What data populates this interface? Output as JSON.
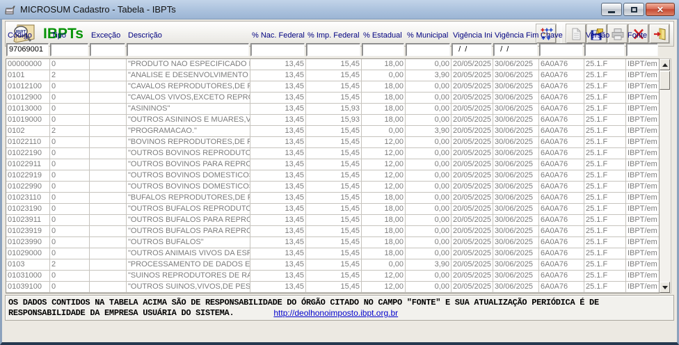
{
  "window": {
    "title": "MICROSUM Cadastro - Tabela - IBPTs",
    "controls": {
      "minimize": "minimize",
      "maximize": "maximize",
      "close": "close"
    }
  },
  "header": {
    "title": "IBPTs"
  },
  "icons": {
    "app": "app-icon",
    "logo": "ibpt-book-magnifier-icon",
    "toolbar": [
      "adjust-columns-icon",
      "document-icon",
      "save-icon",
      "printer-icon",
      "delete-icon",
      "exit-icon"
    ]
  },
  "colors": {
    "band_title_green": "#089408",
    "column_header_navy": "#000080",
    "grid_text_gray": "#7c7c7c",
    "link_blue": "#0000cc",
    "close_button_red": "#c54a33",
    "titlebar_blue": "#a9c0dc"
  },
  "table": {
    "columns": [
      {
        "key": "codigo",
        "label": "Código",
        "filter": "97069001"
      },
      {
        "key": "tipo",
        "label": "Tipo",
        "filter": ""
      },
      {
        "key": "excecao",
        "label": "Exceção",
        "filter": ""
      },
      {
        "key": "descricao",
        "label": "Descrição",
        "filter": ""
      },
      {
        "key": "nac_federal",
        "label": "% Nac. Federal",
        "filter": ""
      },
      {
        "key": "imp_federal",
        "label": "% Imp. Federal",
        "filter": ""
      },
      {
        "key": "estadual",
        "label": "% Estadual",
        "filter": ""
      },
      {
        "key": "municipal",
        "label": "% Municipal",
        "filter": ""
      },
      {
        "key": "vigencia_ini",
        "label": "Vigência Ini.",
        "filter": "  /  /"
      },
      {
        "key": "vigencia_fim",
        "label": "Vigência Fim",
        "filter": "  /  /"
      },
      {
        "key": "chave",
        "label": "Chave",
        "filter": ""
      },
      {
        "key": "versao",
        "label": "Versão",
        "filter": ""
      },
      {
        "key": "fonte",
        "label": "Fonte",
        "filter": ""
      }
    ],
    "rows": [
      [
        "00000000",
        "0",
        "",
        "\"PRODUTO NAO ESPECIFICADO N",
        "13,45",
        "15,45",
        "18,00",
        "0,00",
        "20/05/2025",
        "30/06/2025",
        "6A0A76",
        "25.1.F",
        "IBPT/em"
      ],
      [
        "0101",
        "2",
        "",
        "\"ANALISE E DESENVOLVIMENTO",
        "13,45",
        "15,45",
        "0,00",
        "3,90",
        "20/05/2025",
        "30/06/2025",
        "6A0A76",
        "25.1.F",
        "IBPT/em"
      ],
      [
        "01012100",
        "0",
        "",
        "\"CAVALOS REPRODUTORES,DE R",
        "13,45",
        "15,45",
        "18,00",
        "0,00",
        "20/05/2025",
        "30/06/2025",
        "6A0A76",
        "25.1.F",
        "IBPT/em"
      ],
      [
        "01012900",
        "0",
        "",
        "\"CAVALOS VIVOS,EXCETO REPRO",
        "13,45",
        "15,45",
        "18,00",
        "0,00",
        "20/05/2025",
        "30/06/2025",
        "6A0A76",
        "25.1.F",
        "IBPT/em"
      ],
      [
        "01013000",
        "0",
        "",
        "\"ASININOS\"",
        "13,45",
        "15,93",
        "18,00",
        "0,00",
        "20/05/2025",
        "30/06/2025",
        "6A0A76",
        "25.1.F",
        "IBPT/em"
      ],
      [
        "01019000",
        "0",
        "",
        "\"OUTROS ASININOS E MUARES,V",
        "13,45",
        "15,93",
        "18,00",
        "0,00",
        "20/05/2025",
        "30/06/2025",
        "6A0A76",
        "25.1.F",
        "IBPT/em"
      ],
      [
        "0102",
        "2",
        "",
        "\"PROGRAMACAO.\"",
        "13,45",
        "15,45",
        "0,00",
        "3,90",
        "20/05/2025",
        "30/06/2025",
        "6A0A76",
        "25.1.F",
        "IBPT/em"
      ],
      [
        "01022110",
        "0",
        "",
        "\"BOVINOS REPRODUTORES,DE R",
        "13,45",
        "15,45",
        "12,00",
        "0,00",
        "20/05/2025",
        "30/06/2025",
        "6A0A76",
        "25.1.F",
        "IBPT/em"
      ],
      [
        "01022190",
        "0",
        "",
        "\"OUTROS BOVINOS REPRODUTO",
        "13,45",
        "15,45",
        "12,00",
        "0,00",
        "20/05/2025",
        "30/06/2025",
        "6A0A76",
        "25.1.F",
        "IBPT/em"
      ],
      [
        "01022911",
        "0",
        "",
        "\"OUTROS BOVINOS PARA REPRO",
        "13,45",
        "15,45",
        "12,00",
        "0,00",
        "20/05/2025",
        "30/06/2025",
        "6A0A76",
        "25.1.F",
        "IBPT/em"
      ],
      [
        "01022919",
        "0",
        "",
        "\"OUTROS BOVINOS DOMESTICOS",
        "13,45",
        "15,45",
        "12,00",
        "0,00",
        "20/05/2025",
        "30/06/2025",
        "6A0A76",
        "25.1.F",
        "IBPT/em"
      ],
      [
        "01022990",
        "0",
        "",
        "\"OUTROS BOVINOS DOMESTICOS",
        "13,45",
        "15,45",
        "12,00",
        "0,00",
        "20/05/2025",
        "30/06/2025",
        "6A0A76",
        "25.1.F",
        "IBPT/em"
      ],
      [
        "01023110",
        "0",
        "",
        "\"BUFALOS REPRODUTORES,DE R",
        "13,45",
        "15,45",
        "18,00",
        "0,00",
        "20/05/2025",
        "30/06/2025",
        "6A0A76",
        "25.1.F",
        "IBPT/em"
      ],
      [
        "01023190",
        "0",
        "",
        "\"OUTROS BUFALOS REPRODUTO",
        "13,45",
        "15,45",
        "18,00",
        "0,00",
        "20/05/2025",
        "30/06/2025",
        "6A0A76",
        "25.1.F",
        "IBPT/em"
      ],
      [
        "01023911",
        "0",
        "",
        "\"OUTROS BUFALOS PARA REPRO",
        "13,45",
        "15,45",
        "18,00",
        "0,00",
        "20/05/2025",
        "30/06/2025",
        "6A0A76",
        "25.1.F",
        "IBPT/em"
      ],
      [
        "01023919",
        "0",
        "",
        "\"OUTROS BUFALOS PARA REPRO",
        "13,45",
        "15,45",
        "18,00",
        "0,00",
        "20/05/2025",
        "30/06/2025",
        "6A0A76",
        "25.1.F",
        "IBPT/em"
      ],
      [
        "01023990",
        "0",
        "",
        "\"OUTROS BUFALOS\"",
        "13,45",
        "15,45",
        "18,00",
        "0,00",
        "20/05/2025",
        "30/06/2025",
        "6A0A76",
        "25.1.F",
        "IBPT/em"
      ],
      [
        "01029000",
        "0",
        "",
        "\"OUTROS ANIMAIS VIVOS DA ESP",
        "13,45",
        "15,45",
        "18,00",
        "0,00",
        "20/05/2025",
        "30/06/2025",
        "6A0A76",
        "25.1.F",
        "IBPT/em"
      ],
      [
        "0103",
        "2",
        "",
        "\"PROCESSAMENTO DE DADOS E",
        "13,45",
        "15,45",
        "0,00",
        "3,90",
        "20/05/2025",
        "30/06/2025",
        "6A0A76",
        "25.1.F",
        "IBPT/em"
      ],
      [
        "01031000",
        "0",
        "",
        "\"SUINOS REPRODUTORES DE RA",
        "13,45",
        "15,45",
        "12,00",
        "0,00",
        "20/05/2025",
        "30/06/2025",
        "6A0A76",
        "25.1.F",
        "IBPT/em"
      ],
      [
        "01039100",
        "0",
        "",
        "\"OUTROS SUINOS,VIVOS,DE PES",
        "13,45",
        "15,45",
        "12,00",
        "0,00",
        "20/05/2025",
        "30/06/2025",
        "6A0A76",
        "25.1.F",
        "IBPT/em"
      ]
    ]
  },
  "footer": {
    "line1": "OS DADOS CONTIDOS NA TABELA ACIMA SÃO DE RESPONSABILIDADE DO ÓRGÃO CITADO NO CAMPO \"FONTE\" E SUA ATUALIZAÇÃO PERIÓDICA É DE",
    "line2": "RESPONSABILIDADE DA EMPRESA USUÁRIA DO SISTEMA.",
    "link": "http://deolhonoimposto.ibpt.org.br"
  }
}
